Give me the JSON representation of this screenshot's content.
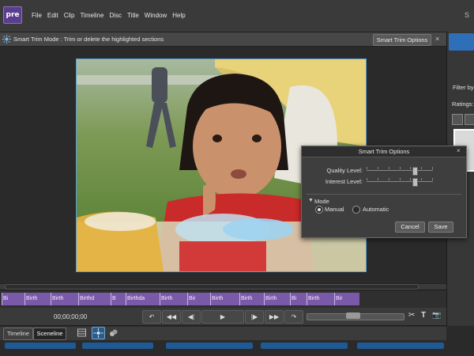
{
  "app": {
    "logo_text": "pre"
  },
  "menu": [
    "File",
    "Edit",
    "Clip",
    "Timeline",
    "Disc",
    "Title",
    "Window",
    "Help"
  ],
  "menu_right": "S",
  "smart_trim_bar": {
    "text": "Smart Trim Mode : Trim or delete the highlighted sections",
    "options_button": "Smart Trim Options",
    "close": "×"
  },
  "right_panel": {
    "filter_label": "Filter by",
    "ratings_label": "Ratings:"
  },
  "dialog": {
    "title": "Smart Trim Options",
    "close": "×",
    "quality_label": "Quality Level:",
    "interest_label": "Interest Level:",
    "quality_value": 0.75,
    "interest_value": 0.75,
    "mode_label": "Mode",
    "mode_options": [
      "Manual",
      "Automatic"
    ],
    "mode_selected": "Manual",
    "cancel_button": "Cancel",
    "save_button": "Save"
  },
  "filmstrip": {
    "clips": [
      "Bi",
      "Birth",
      "Birth",
      "Birthd",
      "B",
      "Birthda",
      "Birth",
      "Bir",
      "Birth",
      "Birth",
      "Birth",
      "Bi",
      "Birth",
      "Bir"
    ]
  },
  "transport": {
    "timecode": "00;00;00;00",
    "buttons": [
      "rewind-marker",
      "step-back",
      "frame-back",
      "play",
      "frame-forward",
      "step-forward",
      "shuttle"
    ],
    "glyphs": [
      "↶",
      "◀◀",
      "◀|",
      "▶",
      "|▶",
      "▶▶",
      "↷"
    ],
    "tools": [
      "✂",
      "T",
      "📷"
    ]
  },
  "bottom_tabs": {
    "timeline": "Timeline",
    "sceneline": "Sceneline"
  },
  "colors": {
    "accent": "#2f6fb8",
    "clip": "#7a5aa8",
    "logo": "#5b3d8f"
  }
}
